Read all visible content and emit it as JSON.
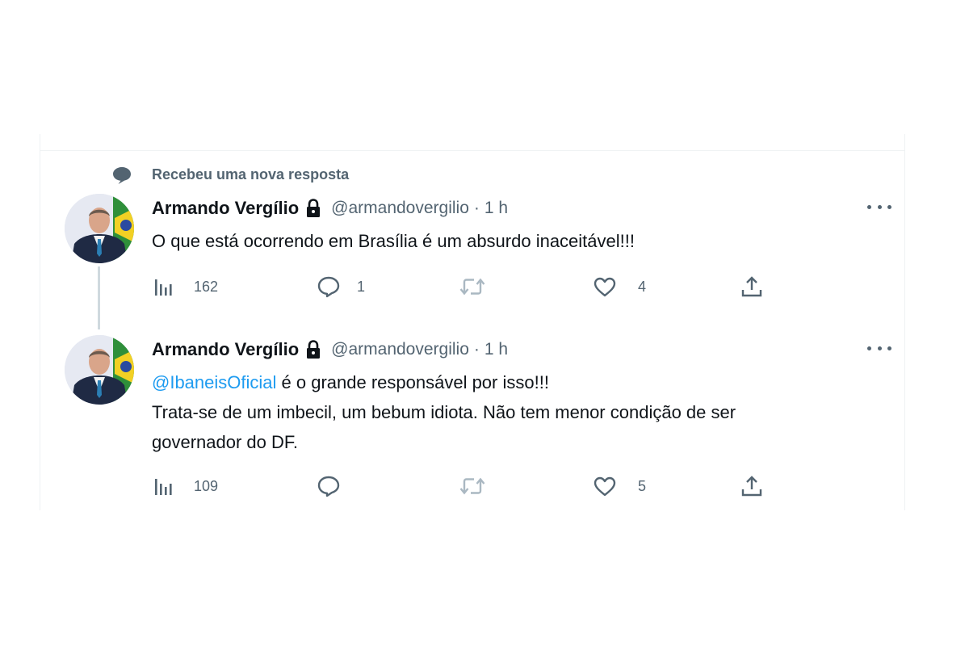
{
  "notice": {
    "icon": "speech-bubble-icon",
    "text": "Recebeu uma nova resposta"
  },
  "tweets": [
    {
      "author": {
        "name": "Armando Vergílio",
        "handle": "@armandovergilio",
        "protected_icon": "lock-icon",
        "avatar": "avatar-man-in-suit-brazil-flag"
      },
      "separator": "·",
      "time": "1 h",
      "body": {
        "line1": "O que está ocorrendo em Brasília é um absurdo inaceitável!!!"
      },
      "actions": {
        "views": "162",
        "replies": "1",
        "retweets": "",
        "likes": "4"
      }
    },
    {
      "author": {
        "name": "Armando Vergílio",
        "handle": "@armandovergilio",
        "protected_icon": "lock-icon",
        "avatar": "avatar-man-in-suit-brazil-flag"
      },
      "separator": "·",
      "time": "1 h",
      "body": {
        "mention": "@IbaneisOficial",
        "line1_rest": " é o grande responsável por isso!!!",
        "line2": "Trata-se de um imbecil, um bebum idiota. Não tem menor condição de ser",
        "line3": "governador do DF."
      },
      "actions": {
        "views": "109",
        "replies": "",
        "retweets": "",
        "likes": "5"
      }
    }
  ],
  "colors": {
    "text_primary": "#0f1419",
    "text_secondary": "#536471",
    "mention": "#1d9bf0",
    "divider": "#eff3f4",
    "thread_line": "#cfd9de"
  }
}
